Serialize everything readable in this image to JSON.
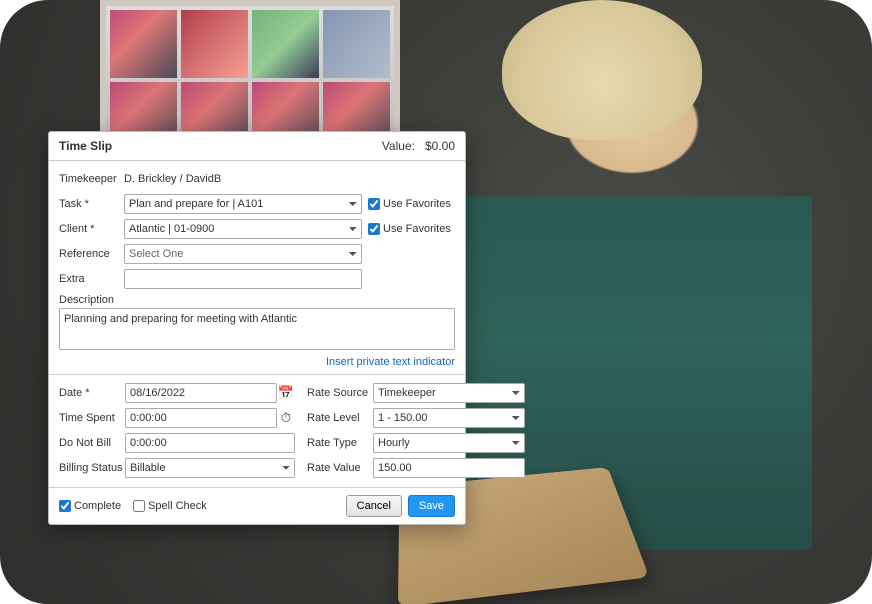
{
  "header": {
    "title": "Time Slip",
    "value_label": "Value:",
    "value": "$0.00"
  },
  "labels": {
    "timekeeper": "Timekeeper",
    "task": "Task *",
    "client": "Client *",
    "reference": "Reference",
    "extra": "Extra",
    "description": "Description",
    "use_favorites": "Use Favorites",
    "insert_link": "Insert private text indicator",
    "date": "Date *",
    "time_spent": "Time Spent",
    "do_not_bill": "Do Not Bill",
    "billing_status": "Billing Status",
    "rate_source": "Rate Source",
    "rate_level": "Rate Level",
    "rate_type": "Rate Type",
    "rate_value": "Rate Value",
    "complete": "Complete",
    "spell_check": "Spell Check",
    "cancel": "Cancel",
    "save": "Save"
  },
  "values": {
    "timekeeper": "D. Brickley  /  DavidB",
    "task": "Plan and prepare for  |  A101",
    "client": "Atlantic  |  01-0900",
    "reference": "Select One",
    "extra": "",
    "description": "Planning and preparing for meeting with Atlantic",
    "date": "08/16/2022",
    "time_spent": "0:00:00",
    "do_not_bill": "0:00:00",
    "billing_status": "Billable",
    "rate_source": "Timekeeper",
    "rate_level": "1 - 150.00",
    "rate_type": "Hourly",
    "rate_value": "150.00"
  },
  "checks": {
    "task_fav": true,
    "client_fav": true,
    "complete": true,
    "spell_check": false
  },
  "icons": {
    "calendar": "📅",
    "timer": "⏱"
  }
}
